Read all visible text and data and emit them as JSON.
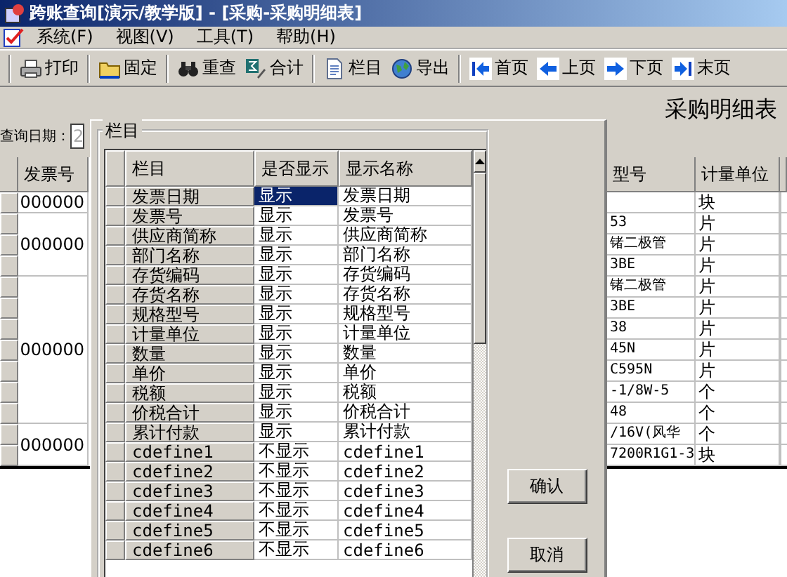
{
  "window": {
    "title": "跨账查询[演示/教学版] - [采购-采购明细表]"
  },
  "menu": [
    {
      "label": "系统(F)"
    },
    {
      "label": "视图(V)"
    },
    {
      "label": "工具(T)"
    },
    {
      "label": "帮助(H)"
    }
  ],
  "toolbar": [
    {
      "items": [
        {
          "label": "打印"
        }
      ]
    },
    {
      "items": [
        {
          "label": "固定"
        }
      ]
    },
    {
      "items": [
        {
          "label": "重查"
        },
        {
          "label": "合计"
        }
      ]
    },
    {
      "items": [
        {
          "label": "栏目"
        },
        {
          "label": "导出"
        }
      ]
    },
    {
      "items": [
        {
          "label": "首页"
        },
        {
          "label": "上页"
        },
        {
          "label": "下页"
        },
        {
          "label": "末页"
        }
      ]
    }
  ],
  "report": {
    "title": "采购明细表",
    "query_label": "查询日期：",
    "query_value": "2"
  },
  "table": {
    "columns": [
      "发票号",
      "型号",
      "计量单位"
    ],
    "invoice_groups": [
      {
        "number": "000000",
        "rows": [
          {
            "model": "",
            "unit": "块"
          }
        ]
      },
      {
        "number": "000000",
        "rows": [
          {
            "model": "53",
            "unit": "片"
          },
          {
            "model": "锗二极管",
            "unit": "片"
          },
          {
            "model": "3BE",
            "unit": "片"
          }
        ]
      },
      {
        "number": "000000",
        "rows": [
          {
            "model": "锗二极管",
            "unit": "片"
          },
          {
            "model": "3BE",
            "unit": "片"
          },
          {
            "model": "38",
            "unit": "片"
          },
          {
            "model": "45N",
            "unit": "片"
          },
          {
            "model": "C595N",
            "unit": "片"
          },
          {
            "model": "-1/8W-5",
            "unit": "个"
          },
          {
            "model": "48",
            "unit": "个"
          }
        ]
      },
      {
        "number": "000000",
        "rows": [
          {
            "model": "/16V(风华",
            "unit": "个"
          },
          {
            "model": "7200R1G1-3",
            "unit": "块"
          }
        ]
      }
    ]
  },
  "dialog": {
    "group_title": "栏目",
    "columns": [
      "栏目",
      "是否显示",
      "显示名称"
    ],
    "rows": [
      {
        "field": "发票日期",
        "display": "显示",
        "name": "发票日期",
        "selected": true
      },
      {
        "field": "发票号",
        "display": "显示",
        "name": "发票号",
        "selected": false
      },
      {
        "field": "供应商简称",
        "display": "显示",
        "name": "供应商简称",
        "selected": false
      },
      {
        "field": "部门名称",
        "display": "显示",
        "name": "部门名称",
        "selected": false
      },
      {
        "field": "存货编码",
        "display": "显示",
        "name": "存货编码",
        "selected": false
      },
      {
        "field": "存货名称",
        "display": "显示",
        "name": "存货名称",
        "selected": false
      },
      {
        "field": "规格型号",
        "display": "显示",
        "name": "规格型号",
        "selected": false
      },
      {
        "field": "计量单位",
        "display": "显示",
        "name": "计量单位",
        "selected": false
      },
      {
        "field": "数量",
        "display": "显示",
        "name": "数量",
        "selected": false
      },
      {
        "field": "单价",
        "display": "显示",
        "name": "单价",
        "selected": false
      },
      {
        "field": "税额",
        "display": "显示",
        "name": "税额",
        "selected": false
      },
      {
        "field": "价税合计",
        "display": "显示",
        "name": "价税合计",
        "selected": false
      },
      {
        "field": "累计付款",
        "display": "显示",
        "name": "累计付款",
        "selected": false
      },
      {
        "field": "cdefine1",
        "display": "不显示",
        "name": "cdefine1",
        "selected": false
      },
      {
        "field": "cdefine2",
        "display": "不显示",
        "name": "cdefine2",
        "selected": false
      },
      {
        "field": "cdefine3",
        "display": "不显示",
        "name": "cdefine3",
        "selected": false
      },
      {
        "field": "cdefine4",
        "display": "不显示",
        "name": "cdefine4",
        "selected": false
      },
      {
        "field": "cdefine5",
        "display": "不显示",
        "name": "cdefine5",
        "selected": false
      },
      {
        "field": "cdefine6",
        "display": "不显示",
        "name": "cdefine6",
        "selected": false
      }
    ],
    "buttons": [
      "确认",
      "取消"
    ]
  }
}
